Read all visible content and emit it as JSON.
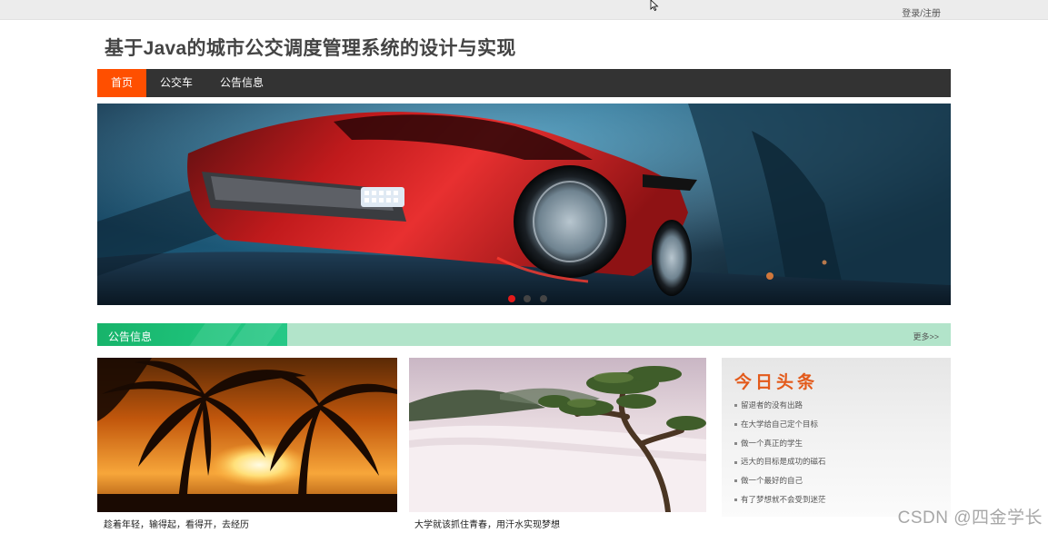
{
  "topbar": {
    "login_register": "登录/注册"
  },
  "site": {
    "title": "基于Java的城市公交调度管理系统的设计与实现"
  },
  "nav": {
    "items": [
      {
        "label": "首页",
        "active": true
      },
      {
        "label": "公交车",
        "active": false
      },
      {
        "label": "公告信息",
        "active": false
      }
    ]
  },
  "banner": {
    "slide_count": 3,
    "active_slide": 1
  },
  "notice_section": {
    "title": "公告信息",
    "more": "更多>>"
  },
  "cards": [
    {
      "caption": "趁着年轻，输得起，看得开，去经历"
    },
    {
      "caption": "大学就该抓住青春，用汗水实现梦想"
    }
  ],
  "headlines": {
    "title": "今日头条",
    "items": [
      "留退者的没有出路",
      "在大学给自己定个目标",
      "做一个真正的学生",
      "远大的目标是成功的磁石",
      "做一个最好的自己",
      "有了梦想就不会受到迷茫"
    ]
  },
  "watermark": "CSDN @四金学长",
  "colors": {
    "nav_bg": "#333333",
    "nav_active": "#ff4f00",
    "section_tab": "#1cbf76",
    "section_bar": "#b2e4ca",
    "headline_title": "#e35a1b"
  }
}
